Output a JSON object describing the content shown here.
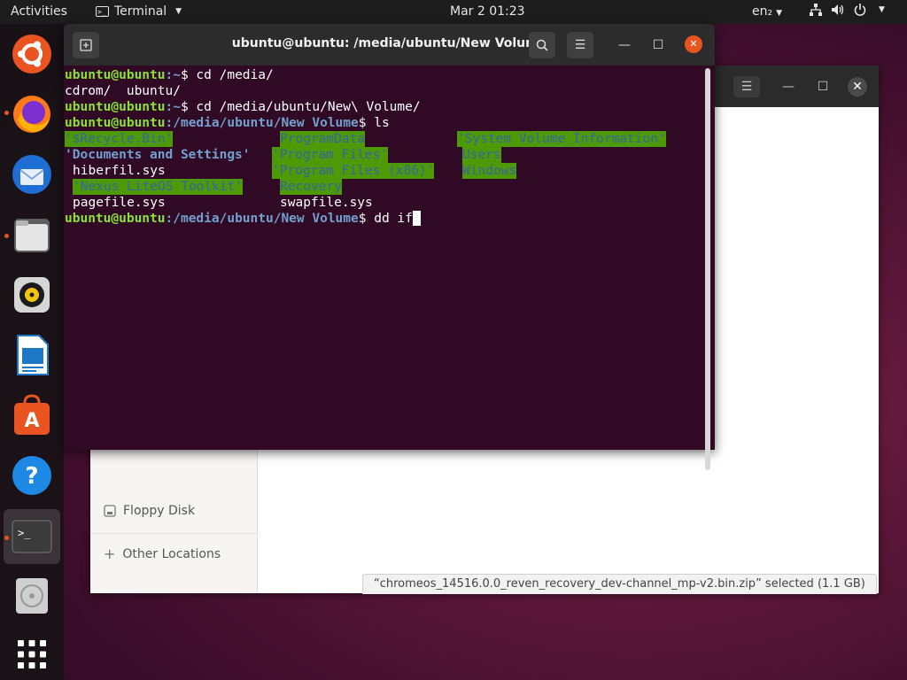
{
  "topbar": {
    "activities": "Activities",
    "app_name": "Terminal",
    "clock": "Mar 2  01:23",
    "lang": "en₂"
  },
  "terminal": {
    "title": "ubuntu@ubuntu: /media/ubuntu/New Volume",
    "user_host": "ubuntu@ubuntu",
    "lines": {
      "l1_path": ":~",
      "l1_cmd": "$ cd /media/",
      "l2_out": "cdrom/  ubuntu/",
      "l3_path": ":~",
      "l3_cmd": "$ cd /media/ubuntu/New\\ Volume/",
      "l4_path": ":/media/ubuntu/New Volume",
      "l4_cmd": "$ ls",
      "l9_path": ":/media/ubuntu/New Volume",
      "l9_cmd": "$ dd if"
    },
    "ls": {
      "c1": [
        "'$Recycle.Bin'",
        "'Documents and Settings'",
        "hiberfil.sys",
        "'Nexus LiteOS Toolkit'",
        "pagefile.sys"
      ],
      "c2": [
        "ProgramData",
        "'Program Files'",
        "'Program Files (x86)'",
        "Recovery",
        "swapfile.sys"
      ],
      "c3": [
        "'System Volume Information'",
        "Users",
        "Windows"
      ]
    }
  },
  "filemanager": {
    "sidebar": {
      "floppy": "Floppy Disk",
      "other": "Other Locations"
    },
    "status": "“chromeos_14516.0.0_reven_recovery_dev-channel_mp-v2.bin.zip” selected  (1.1 GB)"
  },
  "colors": {
    "terminal_bg": "#300a24",
    "prompt_user": "#8ae234",
    "prompt_path": "#729fcf",
    "highlight_bg": "#4e9a06",
    "accent": "#e95420"
  }
}
